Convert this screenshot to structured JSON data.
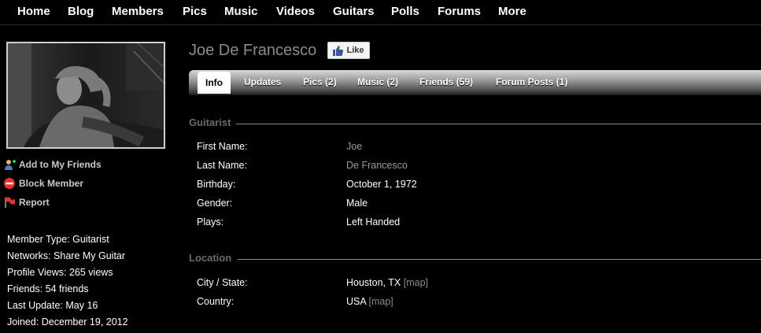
{
  "nav": [
    "Home",
    "Blog",
    "Members",
    "Pics",
    "Music",
    "Videos",
    "Guitars",
    "Polls",
    "Forums",
    "More"
  ],
  "profile": {
    "name": "Joe De Francesco",
    "like_label": "Like"
  },
  "actions": [
    "Add to My Friends",
    "Block Member",
    "Report"
  ],
  "member_info": [
    "Member Type: Guitarist",
    "Networks: Share My Guitar",
    "Profile Views: 265 views",
    "Friends: 54 friends",
    "Last Update: May 16",
    "Joined: December 19, 2012"
  ],
  "tabs": [
    "Info",
    "Updates",
    "Pics (2)",
    "Music (2)",
    "Friends (59)",
    "Forum Posts (1)"
  ],
  "guitarist_section": {
    "title": "Guitarist",
    "rows": [
      {
        "label": "First Name:",
        "value": "Joe"
      },
      {
        "label": "Last Name:",
        "value": "De Francesco"
      },
      {
        "label": "Birthday:",
        "value": "October 1, 1972"
      },
      {
        "label": "Gender:",
        "value": "Male"
      },
      {
        "label": "Plays:",
        "value": "Left Handed"
      }
    ]
  },
  "location_section": {
    "title": "Location",
    "rows": [
      {
        "label": "City / State:",
        "value": "Houston, TX",
        "link": "[map]"
      },
      {
        "label": "Country:",
        "value": "USA",
        "link": "[map]"
      }
    ]
  },
  "colors": {
    "background": "#000000",
    "tabbar_top": "#d9d9d9",
    "muted_text": "#8a8a8a",
    "like_blue": "#3b5998"
  }
}
